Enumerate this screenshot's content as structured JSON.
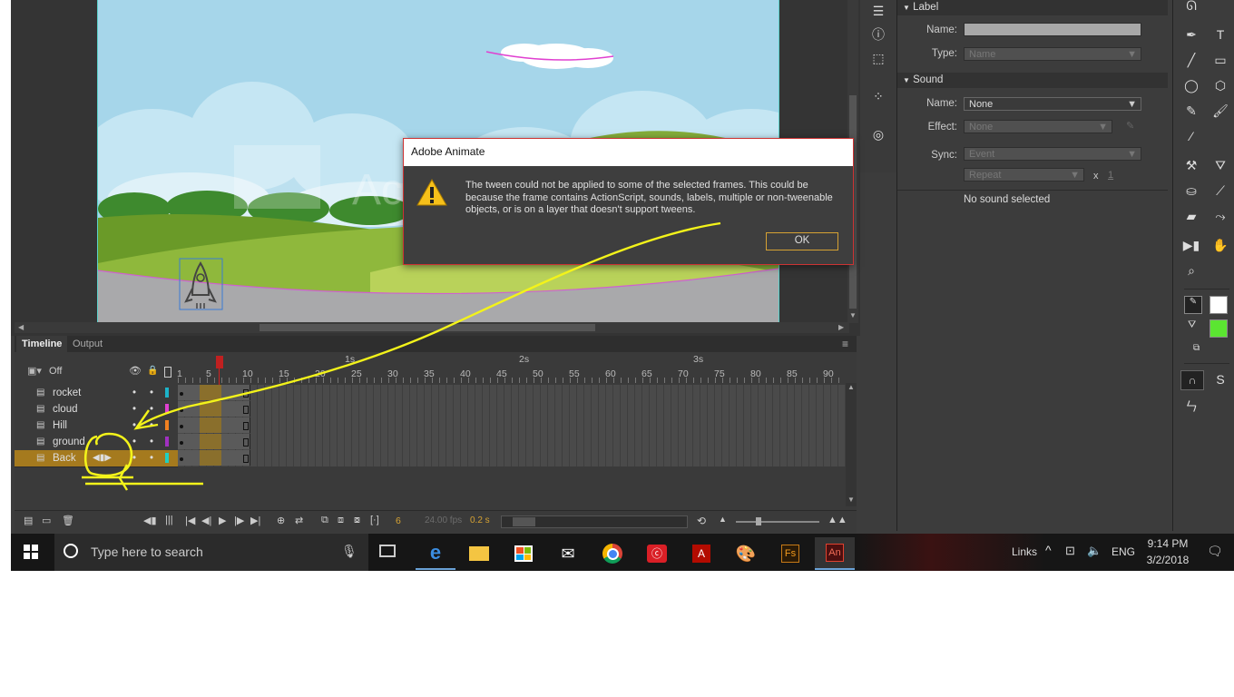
{
  "dialog": {
    "title": "Adobe Animate",
    "message": "The tween could not be applied to some of the selected frames. This could be because the frame contains ActionScript, sounds, labels, multiple or non-tweenable objects, or is on a layer that doesn't support tweens.",
    "ok_label": "OK"
  },
  "stage": {
    "watermark": "Ac"
  },
  "timeline": {
    "tabs": [
      "Timeline",
      "Output"
    ],
    "onion_label": "Off",
    "ruler_seconds": [
      "1s",
      "2s",
      "3s"
    ],
    "ruler_frames": [
      "1",
      "5",
      "10",
      "15",
      "20",
      "25",
      "30",
      "35",
      "40",
      "45",
      "50",
      "55",
      "60",
      "65",
      "70",
      "75",
      "80",
      "85",
      "90"
    ],
    "layers": [
      {
        "name": "rocket",
        "color": "#1cb3c8",
        "selected": false
      },
      {
        "name": "cloud",
        "color": "#e040d0",
        "selected": false
      },
      {
        "name": "Hill",
        "color": "#f08020",
        "selected": false
      },
      {
        "name": "ground",
        "color": "#a030c0",
        "selected": false
      },
      {
        "name": "Back",
        "color": "#20d0c0",
        "selected": true
      }
    ],
    "current_frame": "6",
    "fps": "24.00 fps",
    "time": "0.2 s"
  },
  "properties": {
    "label_section": "Label",
    "label_name_label": "Name:",
    "label_type_label": "Type:",
    "label_type_value": "Name",
    "sound_section": "Sound",
    "sound_name_label": "Name:",
    "sound_name_value": "None",
    "effect_label": "Effect:",
    "effect_value": "None",
    "sync_label": "Sync:",
    "sync_value": "Event",
    "repeat_value": "Repeat",
    "repeat_x": "x",
    "repeat_count": "1",
    "no_sound": "No sound selected"
  },
  "taskbar": {
    "search_placeholder": "Type here to search",
    "links": "Links",
    "lang": "ENG",
    "time": "9:14 PM",
    "date": "3/2/2018",
    "apps": [
      "Edge",
      "File Explorer",
      "Store",
      "Mail",
      "Chrome",
      "Creative Cloud",
      "Acrobat",
      "Paint",
      "Fuse",
      "Animate"
    ]
  },
  "colors": {
    "accent": "#d6a233",
    "annotation": "#f3f31a",
    "selected_layer": "#a57a1e"
  }
}
